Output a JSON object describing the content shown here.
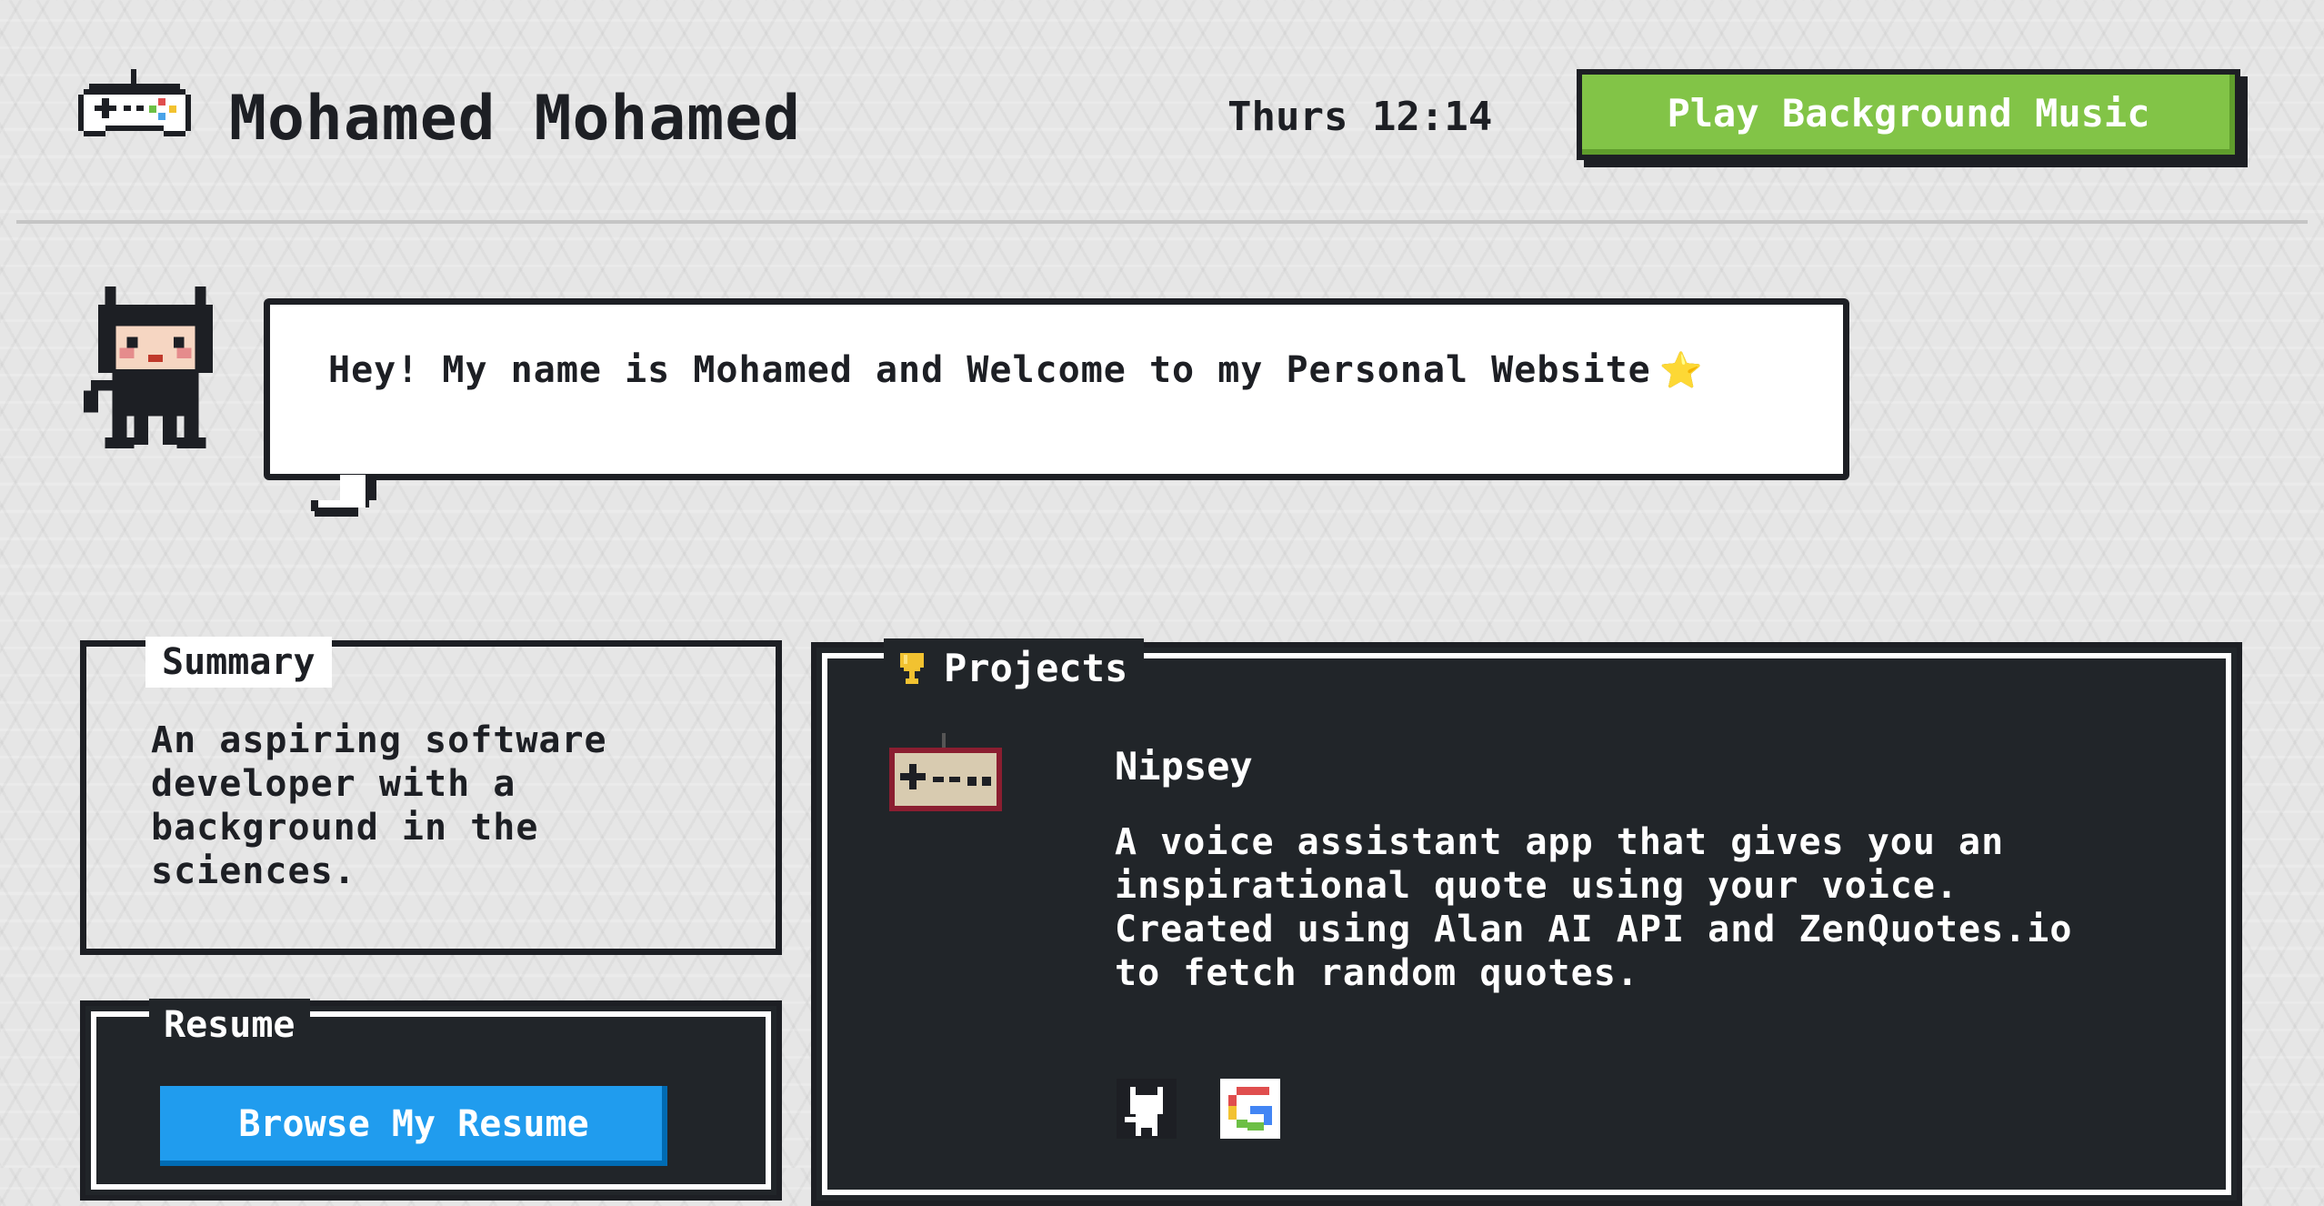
{
  "header": {
    "title": "Mohamed Mohamed",
    "clock": "Thurs 12:14",
    "music_button": "Play Background Music",
    "logo_icon": "gamepad-icon"
  },
  "greeting": {
    "text": "Hey! My name is Mohamed and Welcome to my Personal Website",
    "star": "⭐",
    "mascot_icon": "octocat-mascot-icon"
  },
  "summary": {
    "title": "Summary",
    "text": "An aspiring software developer with a background in the sciences."
  },
  "resume": {
    "title": "Resume",
    "button": "Browse My Resume"
  },
  "projects": {
    "title": "Projects",
    "title_icon": "trophy-icon",
    "items": [
      {
        "name": "Nipsey",
        "description": "A voice assistant app that gives you an inspirational quote using your voice. Created using Alan AI API and ZenQuotes.io to fetch random quotes.",
        "thumb_icon": "nes-controller-icon",
        "links": [
          "github-icon",
          "google-icon"
        ]
      }
    ]
  },
  "colors": {
    "music_button": "#82c447",
    "resume_button": "#209cee",
    "dark_panel": "#212529",
    "text_dark": "#1d1f24"
  }
}
